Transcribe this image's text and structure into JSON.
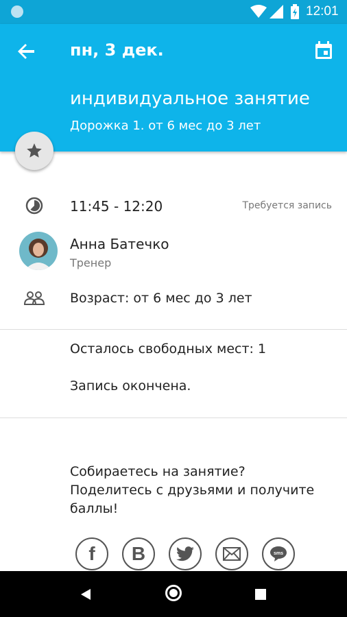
{
  "status_bar": {
    "time": "12:01"
  },
  "header": {
    "date_title": "пн, 3 дек.",
    "lesson_title": "индивидуальное занятие",
    "lesson_subtitle": "Дорожка 1. от 6 мес до 3 лет",
    "accent_color": "#0eb4ea"
  },
  "details": {
    "time_range": "11:45 - 12:20",
    "registration_note": "Требуется запись",
    "coach_name": "Анна Батечко",
    "coach_role": "Тренер",
    "age": "Возраст: от 6 мес до 3 лет"
  },
  "availability": {
    "free_places": "Осталось свободных мест: 1",
    "status": "Запись окончена."
  },
  "share": {
    "line1": "Собираетесь на занятие?",
    "line2": "Поделитесь с друзьями и получите баллы!",
    "buttons": [
      {
        "icon": "facebook-icon",
        "glyph": "f"
      },
      {
        "icon": "vkontakte-icon",
        "glyph": "B"
      },
      {
        "icon": "twitter-icon",
        "glyph": ""
      },
      {
        "icon": "mail-icon",
        "glyph": ""
      },
      {
        "icon": "sms-icon",
        "glyph": "sms"
      }
    ]
  }
}
